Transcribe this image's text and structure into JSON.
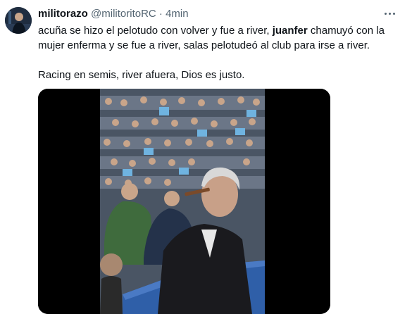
{
  "tweet": {
    "display_name": "militorazo",
    "handle": "@militoritoRC",
    "separator": "·",
    "time": "4min",
    "text_line1_before": "acuña se hizo el pelotudo con volver y fue a river, ",
    "text_line1_bold": "juanfer",
    "text_line1_after": " chamuyó con la mujer enferma y se fue a river, salas pelotudeó al club para irse a river.",
    "text_line2": "Racing en semis, river afuera, Dios es justo."
  },
  "icons": {
    "more": "more-horizontal-icon",
    "avatar": "user-avatar"
  },
  "colors": {
    "text": "#0f1419",
    "secondary": "#536471",
    "stadium_seat": "#2f5fa8",
    "crowd_shirt": "#6fb3e0"
  }
}
